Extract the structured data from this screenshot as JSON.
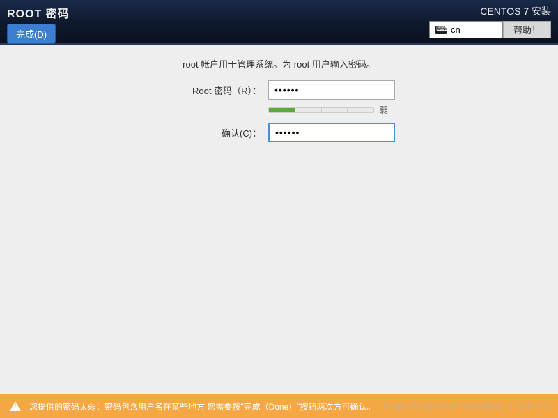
{
  "header": {
    "title": "ROOT 密码",
    "done_button": "完成(D)",
    "install_title": "CENTOS 7 安装",
    "language": "cn",
    "help_button": "帮助！"
  },
  "form": {
    "hint": "root 帐户用于管理系统。为 root 用户输入密码。",
    "password_label": "Root 密码（R）：",
    "password_value": "••••••",
    "confirm_label": "确认(C)：",
    "confirm_value": "••••••",
    "strength_label": "弱"
  },
  "warning": {
    "text": "您提供的密码太弱：密码包含用户名在某些地方  您需要按\"完成（Done）\"按钮两次方可确认。"
  },
  "watermark": "https://blog.csdn.net/weixin_47903763"
}
